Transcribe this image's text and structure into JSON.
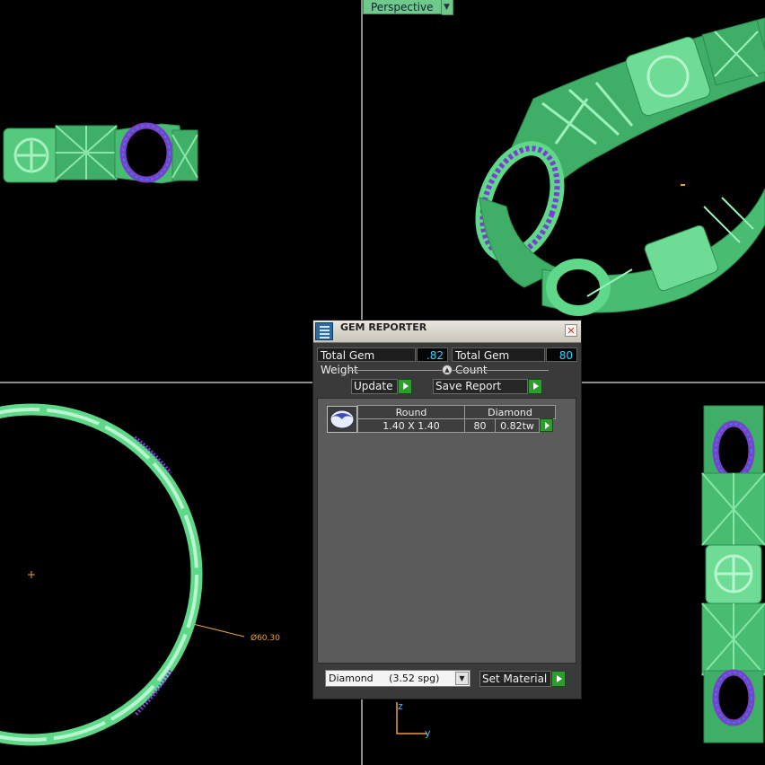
{
  "viewport": {
    "perspective_label": "Perspective",
    "dimension_label": "Ø60.30",
    "axis_z": "z",
    "axis_y": "y"
  },
  "gem_reporter": {
    "title": "GEM REPORTER",
    "total_weight_label": "Total Gem Weight",
    "total_weight_value": ".82",
    "total_count_label": "Total Gem Count",
    "total_count_value": "80",
    "update_label": "Update",
    "save_report_label": "Save Report",
    "gems": [
      {
        "shape": "Round",
        "material": "Diamond",
        "size": "1.40 X 1.40",
        "count": "80",
        "weight": "0.82tw"
      }
    ],
    "material_select": "Diamond     (3.52 spg)",
    "set_material_label": "Set Material"
  },
  "colors": {
    "metal": "#5fd88a",
    "metal_dark": "#2f8a50",
    "gem": "#7a3fd0",
    "background": "#000000"
  }
}
